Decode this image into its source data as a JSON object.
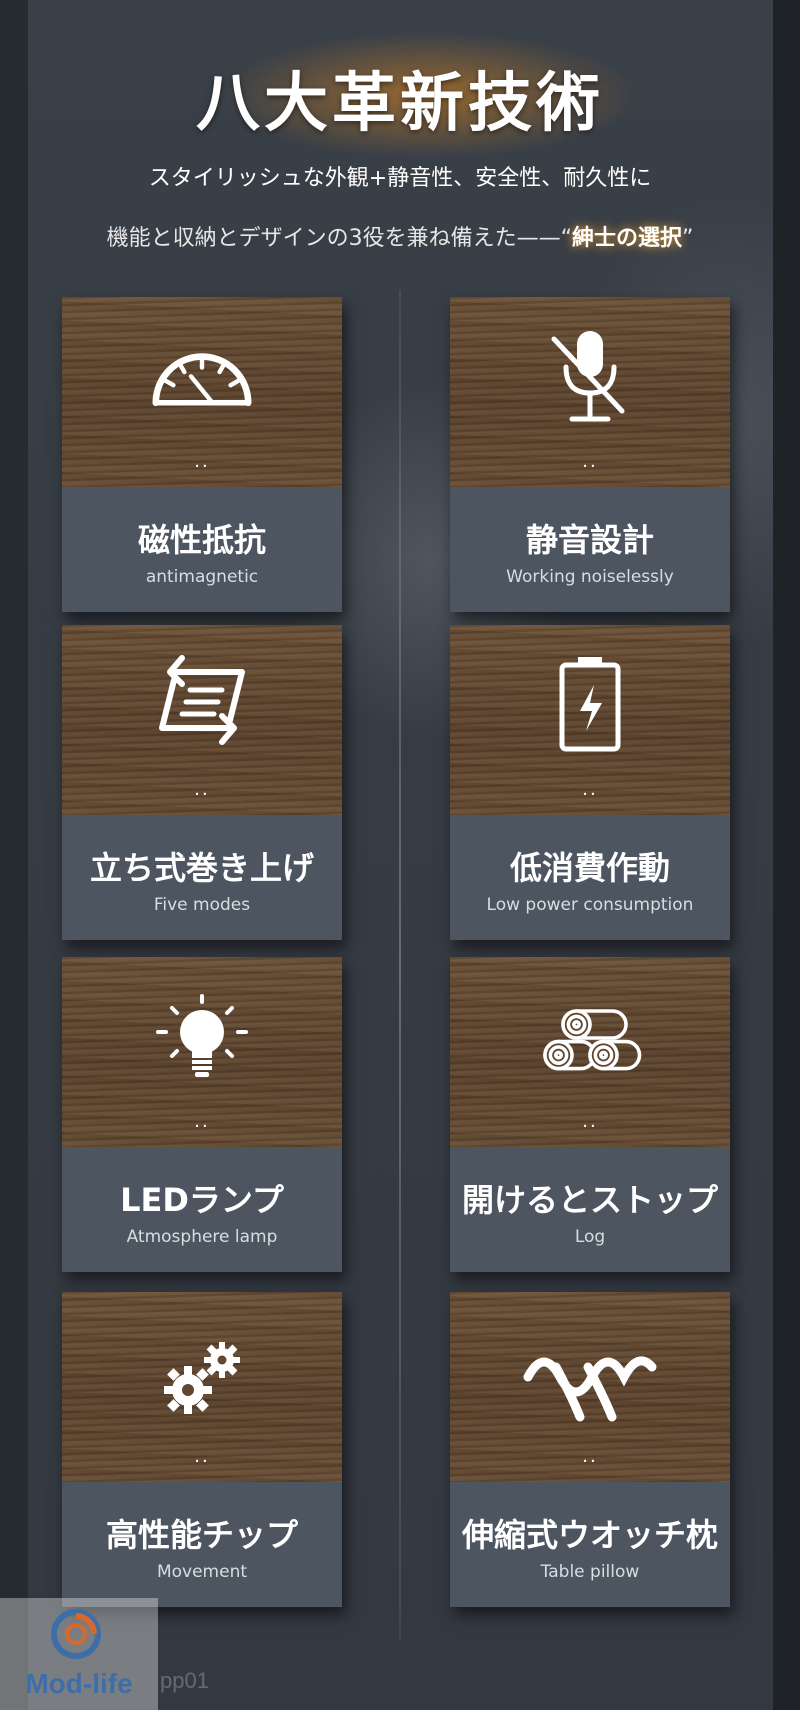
{
  "header": {
    "title": "八大革新技術",
    "subtitle_line1": "スタイリッシュな外観+静音性、安全性、耐久性に",
    "subtitle_line2_prefix": "機能と収納とデザインの3役を兼ね備えた——“",
    "subtitle_line2_highlight": "紳士の選択",
    "subtitle_line2_suffix": "”"
  },
  "features": [
    {
      "name": "磁性抵抗",
      "en": "antimagnetic",
      "icon": "gauge-icon",
      "dots": ".."
    },
    {
      "name": "静音設計",
      "en": "Working noiselessly",
      "icon": "muted-microphone-icon",
      "dots": ".."
    },
    {
      "name": "立ち式巻き上げ",
      "en": "Five modes",
      "icon": "rotate-modes-icon",
      "dots": ".."
    },
    {
      "name": "低消費作動",
      "en": "Low power  consumption",
      "icon": "battery-charging-icon",
      "dots": ".."
    },
    {
      "name": "LEDランプ",
      "en": "Atmosphere lamp",
      "icon": "lightbulb-icon",
      "dots": ".."
    },
    {
      "name": "開けるとストップ",
      "en": "Log",
      "icon": "log-stack-icon",
      "dots": ".."
    },
    {
      "name": "高性能チップ",
      "en": "Movement",
      "icon": "gears-icon",
      "dots": ".."
    },
    {
      "name": "伸縮式ウオッチ枕",
      "en": "Table pillow",
      "icon": "wave-pillow-icon",
      "dots": ".."
    }
  ],
  "logo": {
    "text": "Mod-life"
  },
  "watermark": {
    "text": "pp01"
  },
  "colors": {
    "accent_glow": "#e08a1e",
    "label_bg": "#4d5660",
    "wood": "#5f4731"
  }
}
